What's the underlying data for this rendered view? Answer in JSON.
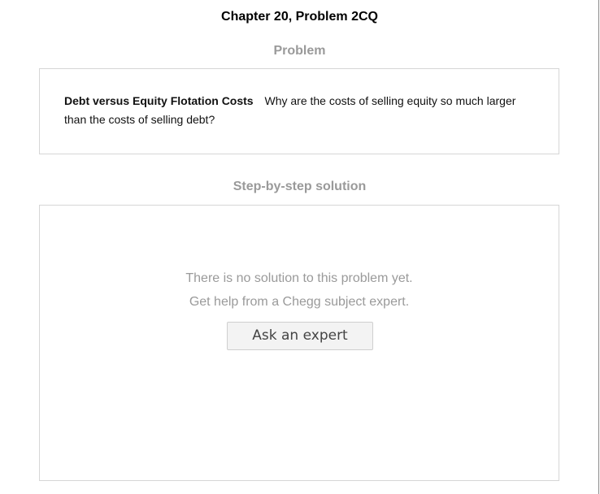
{
  "page": {
    "title": "Chapter 20, Problem 2CQ"
  },
  "problem": {
    "heading": "Problem",
    "term": "Debt versus Equity Flotation Costs",
    "question": "Why are the costs of selling equity so much larger than the costs of selling debt?"
  },
  "solution": {
    "heading": "Step-by-step solution",
    "message_line1": "There is no solution to this problem yet.",
    "message_line2": "Get help from a Chegg subject expert.",
    "ask_button_label": "Ask an expert"
  }
}
